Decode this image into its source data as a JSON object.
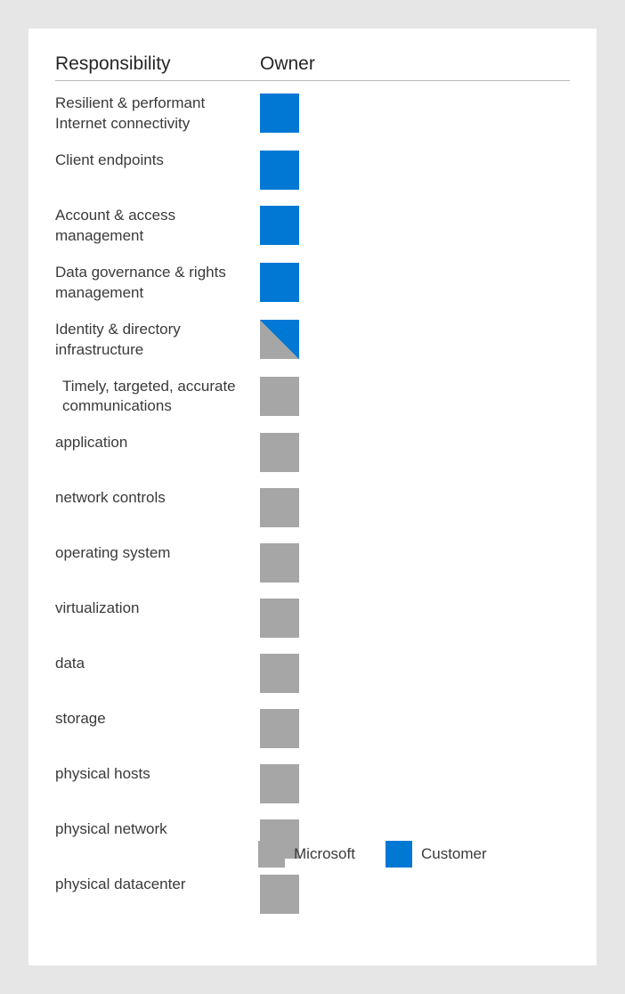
{
  "headers": {
    "responsibility": "Responsibility",
    "owner": "Owner"
  },
  "legend": {
    "microsoft": "Microsoft",
    "customer": "Customer"
  },
  "colors": {
    "customer": "#0078d4",
    "microsoft": "#a6a6a6"
  },
  "rows": [
    {
      "label": "Resilient & performant Internet connectivity",
      "owner": "customer",
      "indent": false
    },
    {
      "label": "Client endpoints",
      "owner": "customer",
      "indent": false
    },
    {
      "label": "Account & access management",
      "owner": "customer",
      "indent": false
    },
    {
      "label": "Data governance & rights management",
      "owner": "customer",
      "indent": false
    },
    {
      "label": "Identity & directory infrastructure",
      "owner": "shared",
      "indent": false
    },
    {
      "label": "Timely, targeted, accurate communications",
      "owner": "microsoft",
      "indent": true
    },
    {
      "label": "application",
      "owner": "microsoft",
      "indent": false
    },
    {
      "label": "network controls",
      "owner": "microsoft",
      "indent": false
    },
    {
      "label": "operating system",
      "owner": "microsoft",
      "indent": false
    },
    {
      "label": "virtualization",
      "owner": "microsoft",
      "indent": false
    },
    {
      "label": "data",
      "owner": "microsoft",
      "indent": false
    },
    {
      "label": "storage",
      "owner": "microsoft",
      "indent": false
    },
    {
      "label": "physical hosts",
      "owner": "microsoft",
      "indent": false
    },
    {
      "label": "physical network",
      "owner": "microsoft",
      "indent": false
    },
    {
      "label": "physical datacenter",
      "owner": "microsoft",
      "indent": false
    }
  ],
  "chart_data": {
    "type": "table",
    "title": "Responsibility vs Owner",
    "columns": [
      "Responsibility",
      "Owner"
    ],
    "owner_values": [
      "Customer",
      "Microsoft",
      "Shared (Customer/Microsoft)"
    ],
    "rows": [
      [
        "Resilient & performant Internet connectivity",
        "Customer"
      ],
      [
        "Client endpoints",
        "Customer"
      ],
      [
        "Account & access management",
        "Customer"
      ],
      [
        "Data governance & rights management",
        "Customer"
      ],
      [
        "Identity & directory infrastructure",
        "Shared (Customer/Microsoft)"
      ],
      [
        "Timely, targeted, accurate communications",
        "Microsoft"
      ],
      [
        "application",
        "Microsoft"
      ],
      [
        "network controls",
        "Microsoft"
      ],
      [
        "operating system",
        "Microsoft"
      ],
      [
        "virtualization",
        "Microsoft"
      ],
      [
        "data",
        "Microsoft"
      ],
      [
        "storage",
        "Microsoft"
      ],
      [
        "physical hosts",
        "Microsoft"
      ],
      [
        "physical network",
        "Microsoft"
      ],
      [
        "physical datacenter",
        "Microsoft"
      ]
    ],
    "legend": [
      "Microsoft",
      "Customer"
    ]
  }
}
